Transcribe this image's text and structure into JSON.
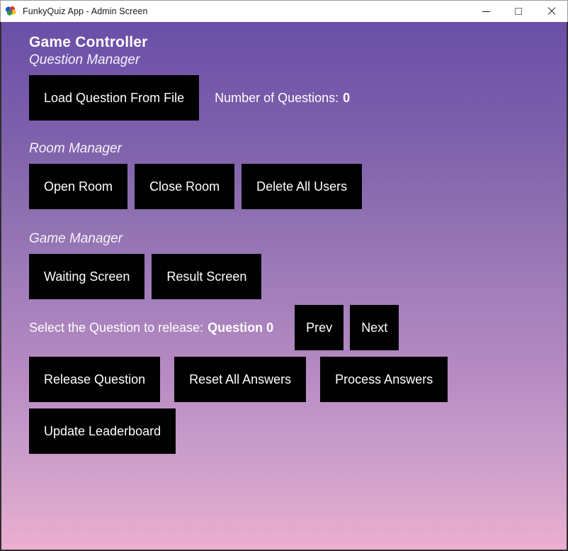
{
  "window": {
    "title": "FunkyQuiz App - Admin Screen",
    "icon": "funkyquiz-app-icon",
    "controls": {
      "minimize": "minimize-icon",
      "maximize": "maximize-icon",
      "close": "close-icon"
    }
  },
  "theme": {
    "gradient_top": "#6a4fa8",
    "gradient_bottom": "#edaed0",
    "button_bg": "#000000",
    "button_text": "#ffffff",
    "heading_text": "#ffffff"
  },
  "page": {
    "title": "Game Controller"
  },
  "sections": {
    "question_manager": {
      "title": "Question Manager",
      "load_button": "Load Question From File",
      "count_label": "Number of Questions:",
      "count_value": "0"
    },
    "room_manager": {
      "title": "Room Manager",
      "buttons": [
        "Open Room",
        "Close Room",
        "Delete All Users"
      ]
    },
    "game_manager": {
      "title": "Game Manager",
      "screen_buttons": [
        "Waiting Screen",
        "Result Screen"
      ],
      "select_label": "Select the Question to release:",
      "select_value": "Question 0",
      "prev_button": "Prev",
      "next_button": "Next",
      "action_buttons": [
        "Release Question",
        "Reset All Answers",
        "Process Answers"
      ],
      "leaderboard_button": "Update Leaderboard"
    }
  }
}
